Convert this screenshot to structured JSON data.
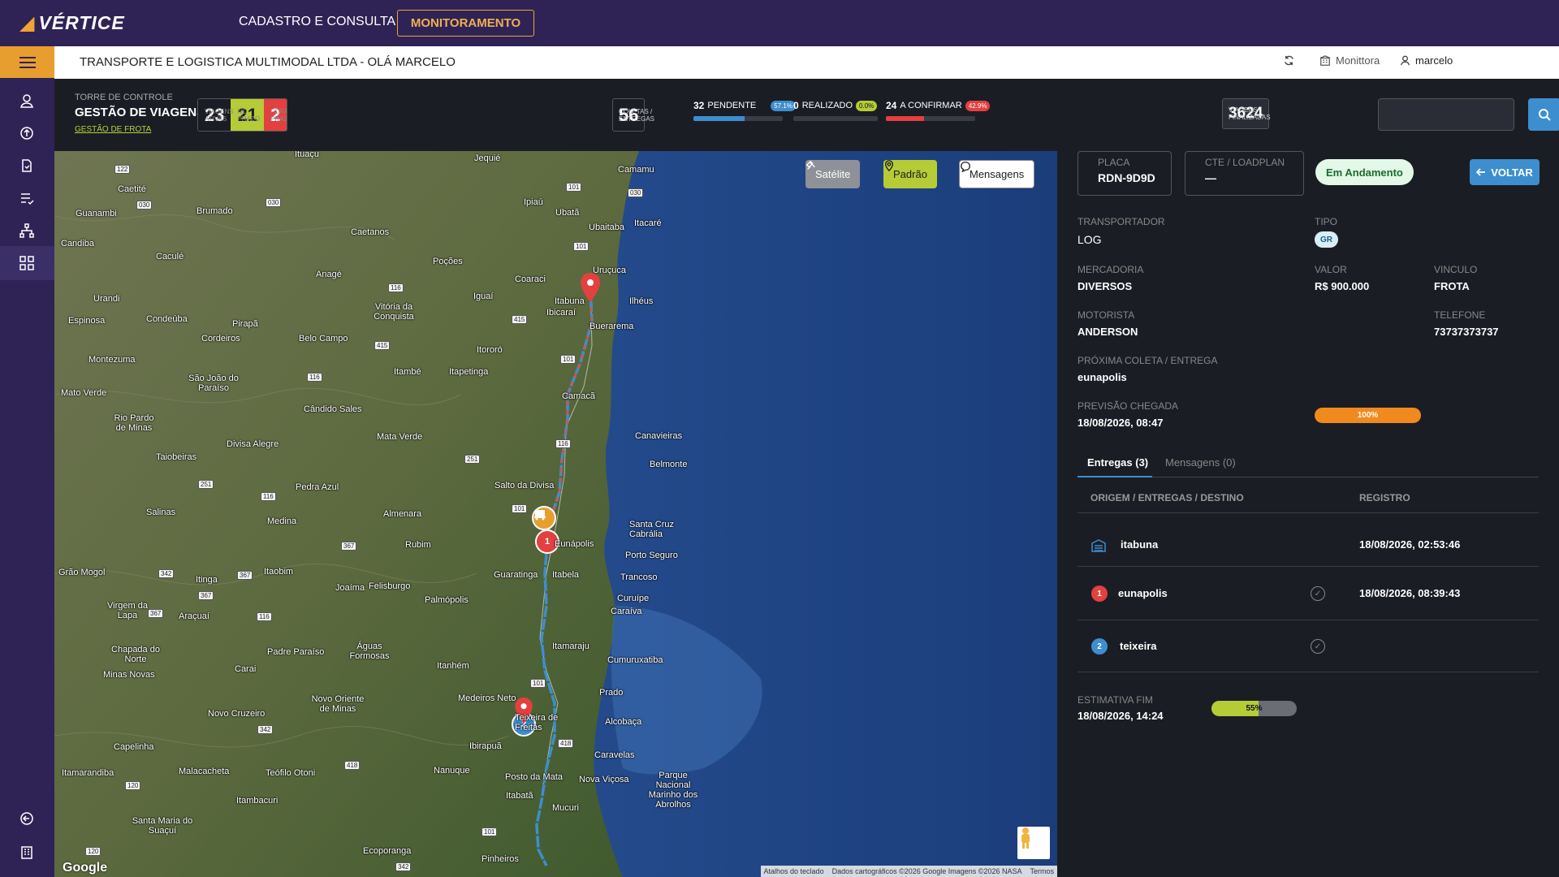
{
  "header": {
    "brand": "VÉRTICE",
    "nav": [
      {
        "label": "CADASTRO E CONSULTA"
      },
      {
        "label": "MONITORAMENTO"
      }
    ]
  },
  "subheader": {
    "company": "TRANSPORTE E LOGISTICA MULTIMODAL LTDA - OLÁ MARCELO",
    "org": "Monittora",
    "user": "marcelo"
  },
  "sidebar": {
    "icons": [
      "menu-icon",
      "user-icon",
      "upload-icon",
      "document-icon",
      "checklist-icon",
      "network-icon",
      "dashboard-icon",
      "logout-icon",
      "building-icon"
    ]
  },
  "stats": {
    "tower_label": "TORRE DE CONTROLE",
    "tower_title": "GESTÃO DE VIAGENS",
    "tower_link": "GESTÃO DE FROTA",
    "viagens_ativas": {
      "num": "23",
      "label": "VIAGENS ATIVAS"
    },
    "no_prazo": {
      "num": "21",
      "label": "NO PRAZO"
    },
    "fora_prazo": {
      "num": "2",
      "label": "FORA DO PRAZO"
    },
    "coletas": {
      "num": "56",
      "label": "COLETAS / ENTREGAS"
    },
    "pendente": {
      "num": "32",
      "label": "PENDENTE",
      "pct": "57.1%",
      "fill": 0.571
    },
    "realizado": {
      "num": "0",
      "label": "REALIZADO",
      "pct": "0.0%",
      "fill": 0.0
    },
    "confirmar": {
      "num": "24",
      "label": "A CONFIRMAR",
      "pct": "42.9%",
      "fill": 0.429
    },
    "finalizadas": {
      "num": "3624",
      "label": "VIAGENS FINALIZADAS"
    }
  },
  "map": {
    "btn_satelite": "Satélite",
    "btn_padrao": "Padrão",
    "btn_mensagens": "Mensagens",
    "google": "Google",
    "attrib_keys": "Atalhos do teclado",
    "attrib_data": "Dados cartográficos ©2026 Google Imagens ©2026 NASA",
    "attrib_terms": "Termos",
    "places": [
      "Ituaçu",
      "Jequié",
      "Camamu",
      "Caetité",
      "Guanambi",
      "Brumado",
      "Ipiaú",
      "Ubatã",
      "Itacaré",
      "Ubaitaba",
      "Caetanos",
      "Candiba",
      "Caculé",
      "Poções",
      "Anagé",
      "Uruçuca",
      "Coaraci",
      "Ilhéus",
      "Itabuna",
      "Ibicaraí",
      "Urandi",
      "Iguaí",
      "Vitória da Conquista",
      "Espinosa",
      "Condeúba",
      "Pirapã",
      "Cordeiros",
      "Belo Campo",
      "Itororó",
      "Buerarema",
      "Montezuma",
      "São João do Paraíso",
      "Itambé",
      "Itapetinga",
      "Mato Verde",
      "Cândido Sales",
      "Camacã",
      "Rio Pardo de Minas",
      "Mata Verde",
      "Canavieiras",
      "Divisa Alegre",
      "Taiobeiras",
      "Belmonte",
      "Pedra Azul",
      "Salto da Divisa",
      "Salinas",
      "Medina",
      "Almenara",
      "Santa Cruz Cabrália",
      "Rubim",
      "Porto Seguro",
      "Grão Mogol",
      "Itinga",
      "Itaobim",
      "Joaíma",
      "Felisburgo",
      "Guaratinga",
      "Itabela",
      "Trancoso",
      "Virgem da Lapa",
      "Araçuaí",
      "Palmópolis",
      "Curuípe",
      "Caraíva",
      "Chapada do Norte",
      "Minas Novas",
      "Padre Paraíso",
      "Águas Formosas",
      "Itamaraju",
      "Cumuruxatiba",
      "Carai",
      "Itanhém",
      "Prado",
      "Novo Cruzeiro",
      "Novo Oriente de Minas",
      "Medeiros Neto",
      "Teixeira de Freitas",
      "Alcobaça",
      "Capelinha",
      "Ibirapuã",
      "Caravelas",
      "Itamarandiba",
      "Malacacheta",
      "Teófilo Otoni",
      "Nanuque",
      "Posto da Mata",
      "Nova Viçosa",
      "Parque Nacional Marinho dos Abrolhos",
      "Itambacuri",
      "Itabatã",
      "Mucuri",
      "Santa Maria do Suaçuí",
      "Ecoporanga",
      "Pinheiros",
      "Eunápolis"
    ],
    "highways": [
      "122",
      "030",
      "101",
      "030",
      "030",
      "101",
      "116",
      "415",
      "116",
      "415",
      "101",
      "116",
      "251",
      "116",
      "101",
      "251",
      "367",
      "342",
      "367",
      "367",
      "116",
      "367",
      "101",
      "342",
      "418",
      "120",
      "418",
      "101",
      "120",
      "342"
    ]
  },
  "detail": {
    "placa_label": "PLACA",
    "placa_value": "RDN-9D9D",
    "cte_label": "CTE / LOADPLAN",
    "cte_value": "—",
    "status": "Em Andamento",
    "back": "VOLTAR",
    "transportador_label": "TRANSPORTADOR",
    "transportador_value": "LOG",
    "tipo_label": "TIPO",
    "tipo_value": "GR",
    "mercadoria_label": "MERCADORIA",
    "mercadoria_value": "DIVERSOS",
    "valor_label": "VALOR",
    "valor_value": "R$ 900.000",
    "vinculo_label": "VINCULO",
    "vinculo_value": "FROTA",
    "motorista_label": "MOTORISTA",
    "motorista_value": "ANDERSON",
    "telefone_label": "TELEFONE",
    "telefone_value": "73737373737",
    "proxima_label": "PRÓXIMA COLETA / ENTREGA",
    "proxima_value": "eunapolis",
    "previsao_label": "PREVISÃO CHEGADA",
    "previsao_value": "18/08/2026, 08:47",
    "previsao_pct": "100%",
    "tab_entregas": "Entregas (3)",
    "tab_mensagens": "Mensagens (0)",
    "col_origem": "ORIGEM / ENTREGAS / DESTINO",
    "col_registro": "REGISTRO",
    "rows": [
      {
        "name": "itabuna",
        "reg": "18/08/2026, 02:53:46",
        "num": ""
      },
      {
        "name": "eunapolis",
        "reg": "18/08/2026, 08:39:43",
        "num": "1"
      },
      {
        "name": "teixeira",
        "reg": "",
        "num": "2"
      }
    ],
    "estimativa_label": "ESTIMATIVA FIM",
    "estimativa_value": "18/08/2026, 14:24",
    "estimativa_pct": "55%",
    "estimativa_fill": 0.55
  },
  "colors": {
    "brand": "#2f2356",
    "accent": "#e89e2f",
    "blue": "#3d8ecf",
    "green": "#b5cc36",
    "red": "#e34040"
  }
}
